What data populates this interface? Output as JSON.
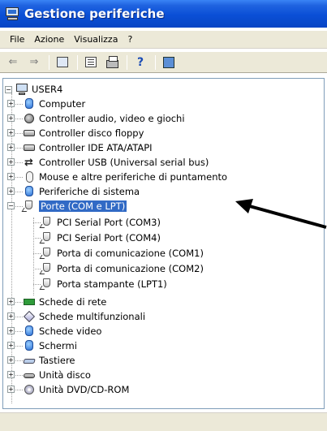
{
  "window": {
    "title": "Gestione periferiche",
    "title_icon": "device-manager-icon"
  },
  "menu": [
    "File",
    "Azione",
    "Visualizza",
    "?"
  ],
  "toolbar": {
    "buttons": [
      "back-arrow-icon",
      "forward-arrow-icon",
      "show-hide-tree-icon",
      "properties-icon",
      "print-icon",
      "help-icon",
      "scan-hardware-icon"
    ]
  },
  "tree": {
    "root": "USER4",
    "categories": [
      {
        "label": "Computer",
        "icon": "computer-icon"
      },
      {
        "label": "Controller audio, video e giochi",
        "icon": "speaker-icon"
      },
      {
        "label": "Controller disco floppy",
        "icon": "floppy-icon"
      },
      {
        "label": "Controller IDE ATA/ATAPI",
        "icon": "ide-controller-icon"
      },
      {
        "label": "Controller USB (Universal serial bus)",
        "icon": "usb-icon"
      },
      {
        "label": "Mouse e altre periferiche di puntamento",
        "icon": "mouse-icon"
      },
      {
        "label": "Periferiche di sistema",
        "icon": "system-device-icon"
      },
      {
        "label": "Porte (COM e LPT)",
        "icon": "port-icon",
        "selected": true,
        "expanded": true,
        "children": [
          "PCI Serial Port (COM3)",
          "PCI Serial Port (COM4)",
          "Porta di comunicazione (COM1)",
          "Porta di comunicazione (COM2)",
          "Porta stampante (LPT1)"
        ]
      },
      {
        "label": "Schede di rete",
        "icon": "network-card-icon"
      },
      {
        "label": "Schede multifunzionali",
        "icon": "multifunction-icon"
      },
      {
        "label": "Schede video",
        "icon": "display-adapter-icon"
      },
      {
        "label": "Schermi",
        "icon": "monitor-icon"
      },
      {
        "label": "Tastiere",
        "icon": "keyboard-icon"
      },
      {
        "label": "Unità disco",
        "icon": "disk-drive-icon"
      },
      {
        "label": "Unità DVD/CD-ROM",
        "icon": "cdrom-icon"
      }
    ]
  },
  "colors": {
    "titlebar": "#0a4fd6",
    "selection": "#316ac5",
    "chrome": "#ece9d8"
  }
}
